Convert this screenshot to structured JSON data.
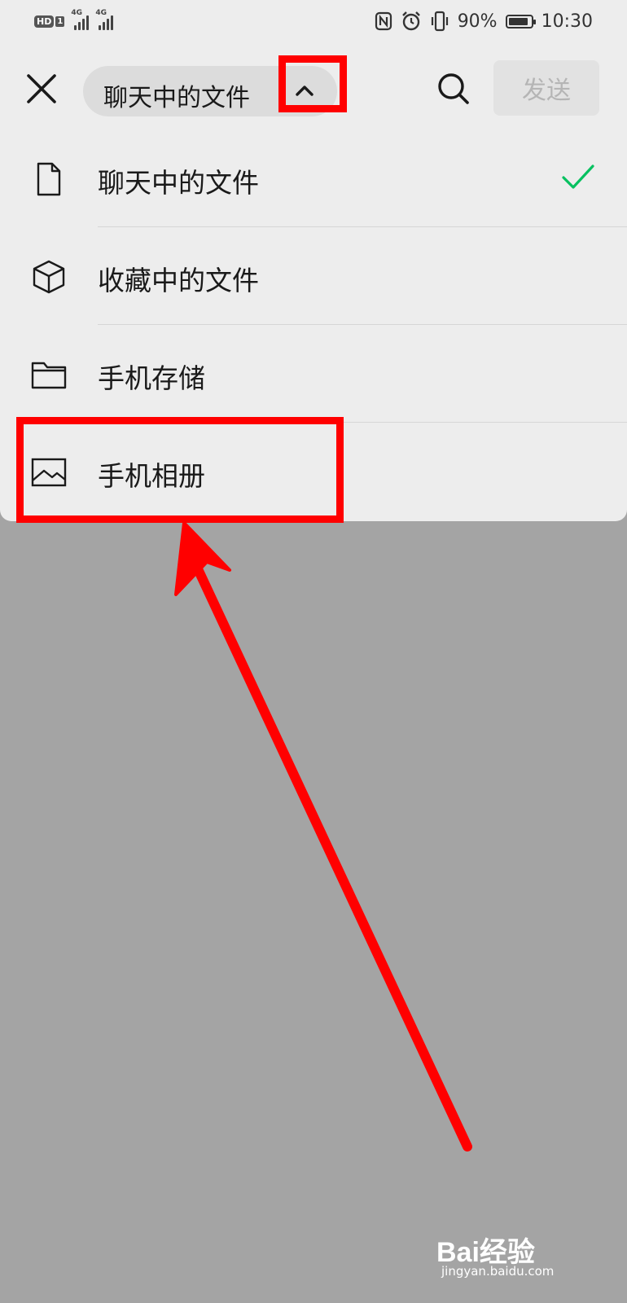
{
  "status_bar": {
    "hd_label": "HD",
    "sim_label": "1",
    "signal1_net": "4G",
    "signal2_net": "4G",
    "battery_percent": "90%",
    "battery_level": 0.9,
    "time": "10:30",
    "icons": [
      "nfc-icon",
      "alarm-icon",
      "vibrate-icon",
      "battery-icon"
    ]
  },
  "header": {
    "source_label": "聊天中的文件",
    "send_label": "发送",
    "icons": [
      "close-icon",
      "chevron-up-icon",
      "search-icon"
    ]
  },
  "menu": {
    "items": [
      {
        "label": "聊天中的文件",
        "icon": "file-icon",
        "selected": true
      },
      {
        "label": "收藏中的文件",
        "icon": "cube-icon",
        "selected": false
      },
      {
        "label": "手机存储",
        "icon": "folder-icon",
        "selected": false
      },
      {
        "label": "手机相册",
        "icon": "image-icon",
        "selected": false
      }
    ]
  },
  "colors": {
    "panel_bg": "#ededed",
    "overlay_bg": "#a4a4a4",
    "check_green": "#07c160",
    "annotation_red": "#ff0000"
  },
  "watermark": {
    "brand": "Bai经验",
    "url": "jingyan.baidu.com"
  }
}
